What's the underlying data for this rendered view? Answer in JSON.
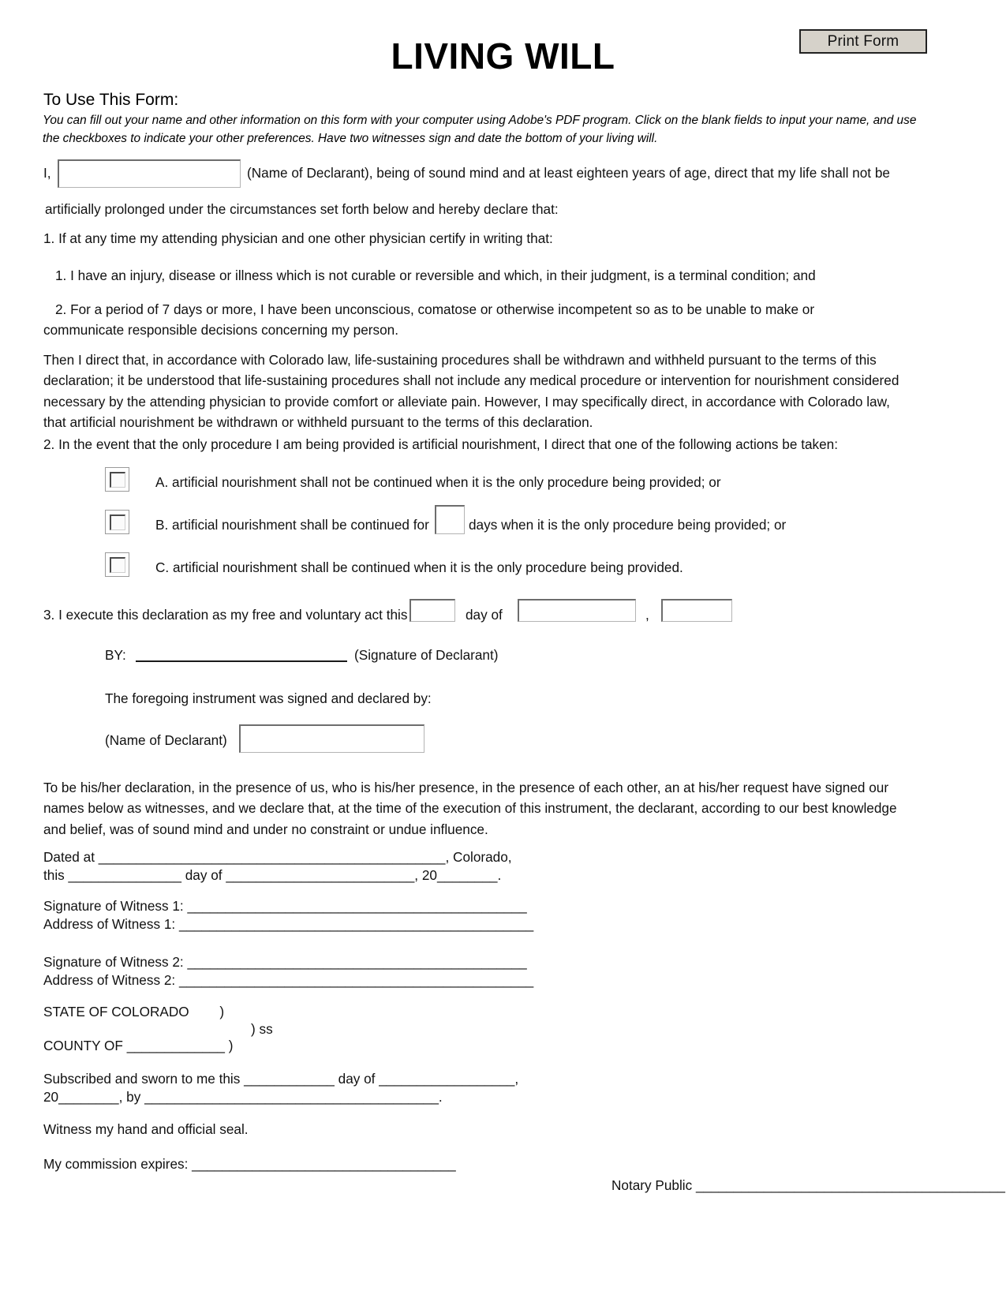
{
  "toolbar": {
    "print_form_label": "Print Form"
  },
  "header": {
    "title": "LIVING WILL"
  },
  "instructions": {
    "heading": "To Use This Form:",
    "body": "You can fill out your name and other information on this form with your computer using Adobe's PDF program. Click on the blank fields to input your name, and use the checkboxes to indicate your other preferences. Have two witnesses sign and date the bottom of your living will."
  },
  "declaration": {
    "i_prefix": "I,",
    "name_field_value": "",
    "name_field_placeholder": "",
    "after_name": "(Name of Declarant), being of sound mind and at least eighteen years of age, direct that my life shall not be",
    "line2": "artificially prolonged under the circumstances set forth below and hereby declare that:",
    "item1_heading": "1. If at any time my attending physician and one other physician certify in writing that:",
    "item1_sub1": "1. I have an injury, disease or illness which is not curable or reversible and which, in their judgment, is a terminal condition; and",
    "item1_sub2": "2. For a period of 7 days or more, I have been unconscious, comatose or otherwise incompetent so as to be unable to make or communicate responsible decisions concerning my person.",
    "then_paragraph": "Then I direct that, in accordance with Colorado law, life-sustaining procedures shall be withdrawn and withheld pursuant to the terms of this declaration; it be understood that life-sustaining procedures shall not include any medical procedure or intervention for nourishment considered necessary by the attending physician to provide comfort or alleviate pain. However, I may specifically direct, in accordance with Colorado law, that artificial nourishment be withdrawn or withheld pursuant to the terms of this declaration."
  },
  "section2": {
    "heading": "2.  In the event that the only procedure I am being provided is artificial nourishment, I direct that one of the following actions be taken:",
    "options": [
      {
        "id": "A",
        "checked": false,
        "text": "A. artificial nourishment shall not be continued when it is the only procedure being provided; or"
      },
      {
        "id": "B",
        "checked": false,
        "text_before": "B. artificial nourishment shall be continued for",
        "days_field_value": "",
        "text_after": "days when it is the only procedure being provided; or"
      },
      {
        "id": "C",
        "checked": false,
        "text": "C. artificial nourishment shall be continued when it is the only procedure being provided."
      }
    ]
  },
  "section3": {
    "lead": "3. I execute this declaration as my free and voluntary act this",
    "day_field_value": "",
    "day_of_label": "day of",
    "month_field_value": "",
    "comma": ",",
    "year_field_value": "",
    "by_label": "BY:",
    "signature_caption": "(Signature of Declarant)",
    "foregoing": "The foregoing instrument was signed and declared by:",
    "name_of_declarant_label": "(Name of Declarant)",
    "declarant_name_field_value": ""
  },
  "witness_block": {
    "paragraph": "To be his/her declaration, in the presence of us, who is his/her presence, in the presence of each other, an at his/her request have signed our names below as witnesses, and we declare that, at the time of the execution of this instrument, the declarant, according to our best knowledge and belief, was of sound mind and under no constraint or undue influence.",
    "dated_at_label": "Dated at",
    "dated_at_blank": "______________________________________________",
    "colorado_suffix": ", Colorado,",
    "this_label": "this",
    "this_blank": "_______________",
    "day_of_label": "day of",
    "day_of_blank": "_________________________",
    "year_prefix": ", 20",
    "year_blank": "________",
    "period": ".",
    "lines": [
      {
        "label": "Signature of Witness 1:",
        "blank": "_____________________________________________"
      },
      {
        "label": "Address of Witness 1:",
        "blank": "_______________________________________________"
      },
      {
        "label": "Signature of Witness 2:",
        "blank": "_____________________________________________"
      },
      {
        "label": "Address of Witness 2:",
        "blank": "_______________________________________________"
      }
    ]
  },
  "notary": {
    "state_label": "STATE OF COLORADO",
    "state_paren": ")",
    "ss_label": ") ss",
    "county_label": "COUNTY OF",
    "county_blank": "_____________",
    "county_paren": ")",
    "subscribed_line1_a": "Subscribed and sworn to me this",
    "subscribed_blank1": "____________",
    "subscribed_day_of": "day of",
    "subscribed_blank2": "__________________",
    "subscribed_comma": ",",
    "subscribed_line2_a": "20",
    "subscribed_blank3": "________",
    "subscribed_by": ", by",
    "subscribed_blank4": "_______________________________________",
    "subscribed_period": ".",
    "witness_seal": "Witness my hand and official seal.",
    "commission_label": "My commission expires:",
    "commission_blank": "___________________________________",
    "notary_public_label": "Notary Public",
    "notary_public_blank": "_________________________________________"
  },
  "colors": {
    "button_face": "#d6d2ca",
    "button_border": "#222222",
    "field_border_dark": "#6d6d6d",
    "field_border_light": "#b4b4b4",
    "text": "#000000"
  }
}
